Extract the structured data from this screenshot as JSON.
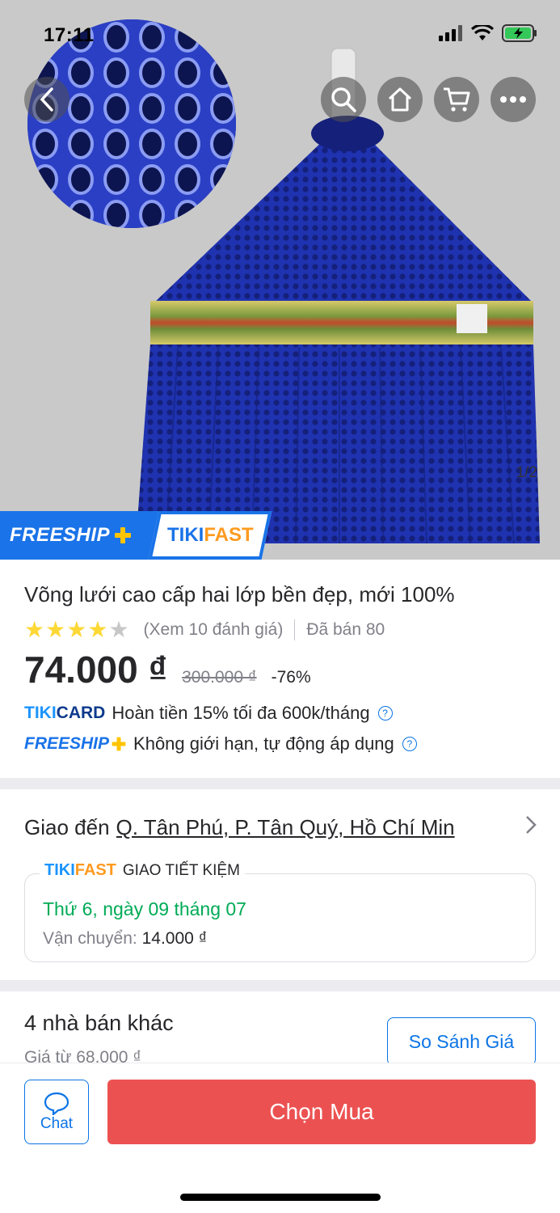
{
  "status_bar": {
    "time": "17:11"
  },
  "gallery": {
    "counter": "1/2"
  },
  "badges": {
    "freeship": "FREESHIP",
    "tikifast_tiki": "TIKI",
    "tikifast_fast": "FAST"
  },
  "product": {
    "title": "Võng lưới cao cấp hai lớp bền đẹp, mới 100%",
    "rating": 4,
    "rating_max": 5,
    "reviews_link": "(Xem 10 đánh giá)",
    "sold": "Đã bán 80",
    "price": "74.000 ₫",
    "old_price": "300.000 ₫",
    "discount": "-76%",
    "promos": {
      "tikicard_brand_tiki": "TIKI",
      "tikicard_brand_card": "CARD",
      "tikicard_text": "Hoàn tiền 15% tối đa 600k/tháng",
      "freeship_brand": "FREESHIP",
      "freeship_text": "Không giới hạn, tự động áp dụng"
    }
  },
  "delivery": {
    "prefix": "Giao đến",
    "address": "Q. Tân Phú, P. Tân Quý, Hồ Chí Min",
    "service_brand_tiki": "TIKI",
    "service_brand_fast": "FAST",
    "service_name": "GIAO TIẾT KIỆM",
    "date": "Thứ 6, ngày 09 tháng 07",
    "fee_label": "Vận chuyển:",
    "fee_value": "14.000 ₫"
  },
  "sellers": {
    "title": "4 nhà bán khác",
    "from_price": "Giá từ 68.000 ₫",
    "compare_label": "So Sánh Giá"
  },
  "bottom_bar": {
    "chat_label": "Chat",
    "buy_label": "Chọn Mua"
  },
  "colors": {
    "brand_blue": "#1a73e8",
    "link_blue": "#0b74e5",
    "buy_red": "#ec5151",
    "star": "#fdd836",
    "green": "#00ab56",
    "freeship_yellow": "#ffc400"
  }
}
